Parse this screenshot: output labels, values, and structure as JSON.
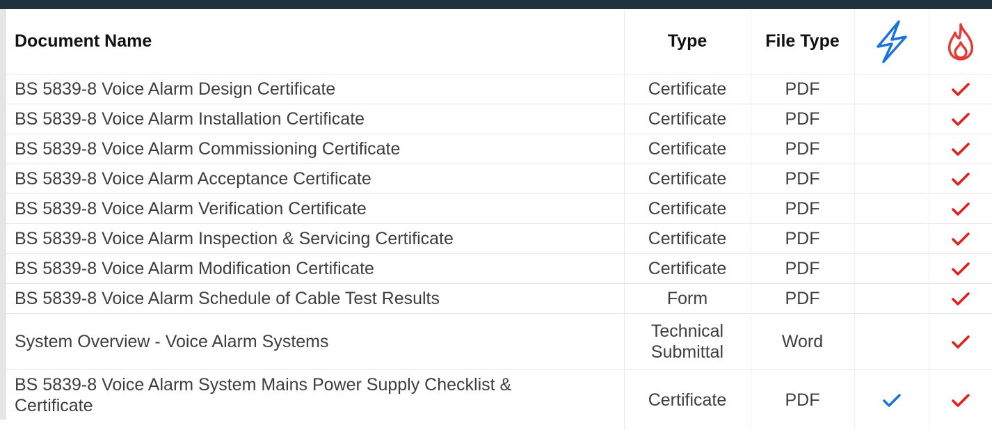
{
  "colors": {
    "header_bar": "#1f323d",
    "power_blue": "#1a73d9",
    "fire_red": "#e53935",
    "check_red": "#e02020",
    "check_blue": "#1a73d9"
  },
  "table": {
    "headers": {
      "name": "Document Name",
      "type": "Type",
      "file_type": "File Type",
      "power_icon": "lightning-bolt-icon",
      "fire_icon": "flame-icon"
    },
    "rows": [
      {
        "name": "BS 5839-8 Voice Alarm Design Certificate",
        "type": "Certificate",
        "file_type": "PDF",
        "power": false,
        "fire": true
      },
      {
        "name": "BS 5839-8 Voice Alarm Installation Certificate",
        "type": "Certificate",
        "file_type": "PDF",
        "power": false,
        "fire": true
      },
      {
        "name": "BS 5839-8 Voice Alarm Commissioning Certificate",
        "type": "Certificate",
        "file_type": "PDF",
        "power": false,
        "fire": true
      },
      {
        "name": "BS 5839-8 Voice Alarm Acceptance Certificate",
        "type": "Certificate",
        "file_type": "PDF",
        "power": false,
        "fire": true
      },
      {
        "name": "BS 5839-8 Voice Alarm Verification Certificate",
        "type": "Certificate",
        "file_type": "PDF",
        "power": false,
        "fire": true
      },
      {
        "name": "BS 5839-8 Voice Alarm Inspection & Servicing Certificate",
        "type": "Certificate",
        "file_type": "PDF",
        "power": false,
        "fire": true
      },
      {
        "name": "BS 5839-8 Voice Alarm Modification Certificate",
        "type": "Certificate",
        "file_type": "PDF",
        "power": false,
        "fire": true
      },
      {
        "name": "BS 5839-8 Voice Alarm Schedule of Cable Test Results",
        "type": "Form",
        "file_type": "PDF",
        "power": false,
        "fire": true
      },
      {
        "name": "System Overview - Voice Alarm Systems",
        "type_line1": "Technical",
        "type_line2": "Submittal",
        "file_type": "Word",
        "power": false,
        "fire": true
      },
      {
        "name_line1": "BS 5839-8 Voice Alarm System Mains Power Supply Checklist &",
        "name_line2": "Certificate",
        "type": "Certificate",
        "file_type": "PDF",
        "power": true,
        "fire": true
      }
    ]
  }
}
